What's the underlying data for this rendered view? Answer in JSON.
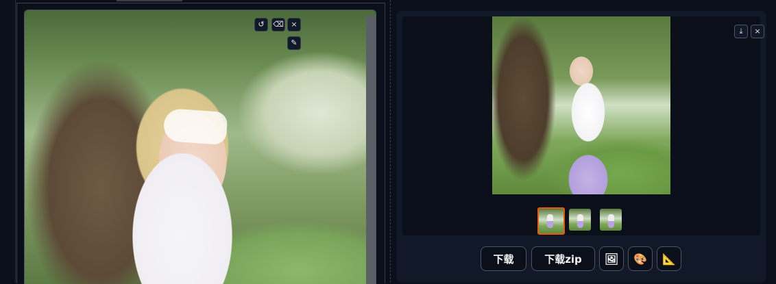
{
  "editor": {
    "tools": {
      "undo_icon": "↺",
      "eraser_icon": "⌫",
      "close_icon": "×",
      "brush_icon": "✎"
    }
  },
  "gallery": {
    "toolbar": {
      "download_icon": "⤓",
      "close_icon": "×"
    },
    "thumbnails_count": 3,
    "selected_thumbnail": 1
  },
  "actions": {
    "download_label": "下载",
    "download_zip_label": "下载zip",
    "image_icon": "🖼",
    "palette_icon": "🎨",
    "ruler_icon": "📐"
  }
}
